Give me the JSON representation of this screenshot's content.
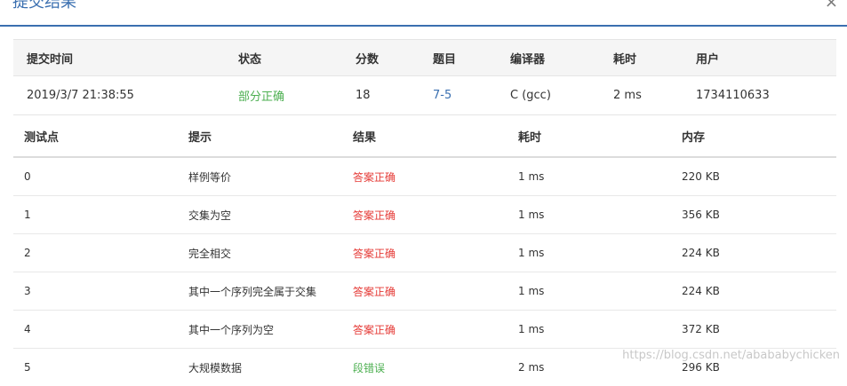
{
  "dialog": {
    "title": "提交结果",
    "close_glyph": "×"
  },
  "summary": {
    "headers": [
      "提交时间",
      "状态",
      "分数",
      "题目",
      "编译器",
      "耗时",
      "用户"
    ],
    "row": {
      "time": "2019/3/7 21:38:55",
      "status": "部分正确",
      "score": "18",
      "problem": "7-5",
      "compiler": "C (gcc)",
      "duration": "2 ms",
      "user": "1734110633"
    }
  },
  "cases": {
    "headers": [
      "测试点",
      "提示",
      "结果",
      "耗时",
      "内存"
    ],
    "rows": [
      {
        "id": "0",
        "hint": "样例等价",
        "result": "答案正确",
        "time": "1 ms",
        "memory": "220 KB"
      },
      {
        "id": "1",
        "hint": "交集为空",
        "result": "答案正确",
        "time": "1 ms",
        "memory": "356 KB"
      },
      {
        "id": "2",
        "hint": "完全相交",
        "result": "答案正确",
        "time": "1 ms",
        "memory": "224 KB"
      },
      {
        "id": "3",
        "hint": "其中一个序列完全属于交集",
        "result": "答案正确",
        "time": "1 ms",
        "memory": "224 KB"
      },
      {
        "id": "4",
        "hint": "其中一个序列为空",
        "result": "答案正确",
        "time": "1 ms",
        "memory": "372 KB"
      },
      {
        "id": "5",
        "hint": "大规模数据",
        "result": "段错误",
        "time": "2 ms",
        "memory": "296 KB"
      }
    ]
  },
  "watermark": "https://blog.csdn.net/abababychicken",
  "colors": {
    "accent": "#3a6fb0",
    "success": "#4caf50",
    "correct": "#e53935",
    "error": "#4caf50"
  }
}
